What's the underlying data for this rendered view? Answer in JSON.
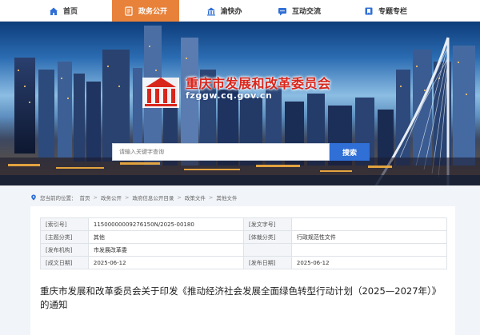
{
  "nav": {
    "items": [
      {
        "label": "首页",
        "icon": "home-icon"
      },
      {
        "label": "政务公开",
        "icon": "document-icon",
        "active": true
      },
      {
        "label": "渝快办",
        "icon": "building-icon"
      },
      {
        "label": "互动交流",
        "icon": "chat-icon"
      },
      {
        "label": "专题专栏",
        "icon": "bookmark-icon"
      }
    ]
  },
  "banner": {
    "title": "重庆市发展和改革委员会",
    "domain": "fzggw.cq.gov.cn"
  },
  "search": {
    "placeholder": "请输入关键字查询",
    "button_label": "搜索"
  },
  "breadcrumb": {
    "prefix": "您当前的位置：",
    "items": [
      "首页",
      "政务公开",
      "政府信息公开目录",
      "政策文件",
      "其他文件"
    ],
    "separator": ">"
  },
  "meta": {
    "rows": [
      {
        "k1": "[索引号]",
        "v1": "11500000009276150N/2025-00180",
        "k2": "[发文字号]",
        "v2": ""
      },
      {
        "k1": "[主题分类]",
        "v1": "其他",
        "k2": "[体裁分类]",
        "v2": "行政规范性文件"
      },
      {
        "k1": "[发布机构]",
        "v1": "市发展改革委",
        "k2": "",
        "v2": ""
      },
      {
        "k1": "[成文日期]",
        "v1": "2025-06-12",
        "k2": "[发布日期]",
        "v2": "2025-06-12"
      }
    ]
  },
  "document": {
    "title": "重庆市发展和改革委员会关于印发《推动经济社会发展全面绿色转型行动计划（2025—2027年）》的通知"
  },
  "colors": {
    "accent_orange": "#e8823a",
    "search_blue": "#2f6fd6",
    "title_red": "#d9261c"
  }
}
